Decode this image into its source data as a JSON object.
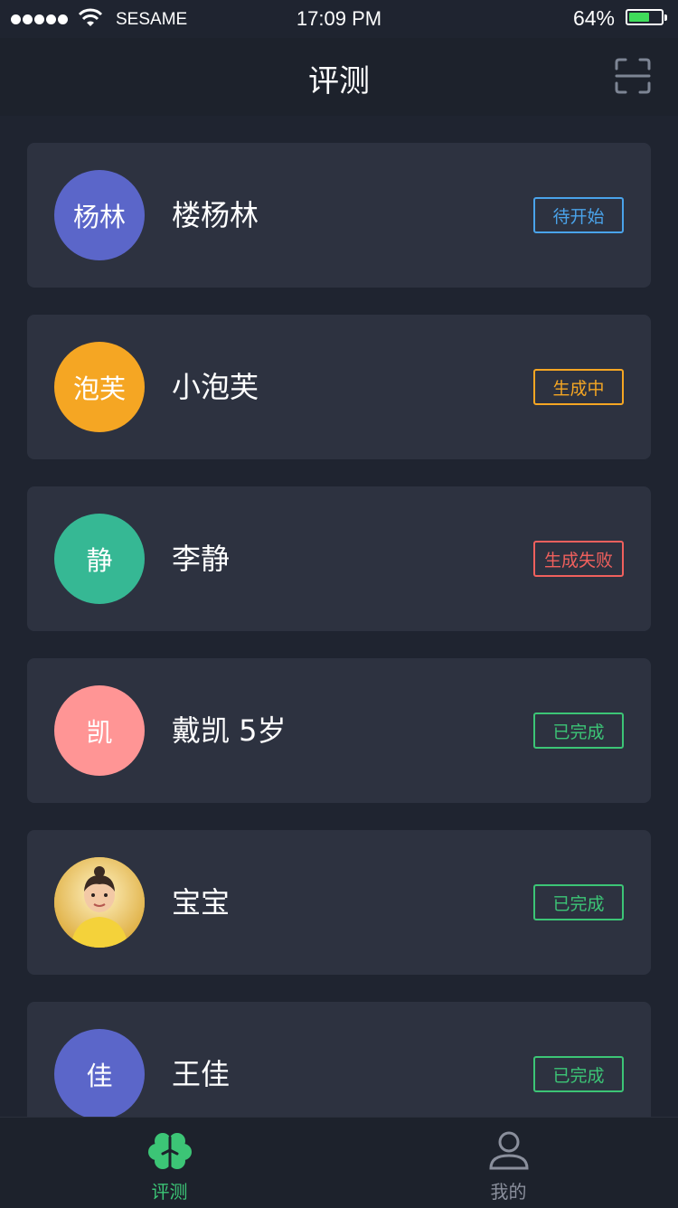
{
  "status_bar": {
    "carrier": "SESAME",
    "time": "17:09 PM",
    "battery_percent": "64%",
    "battery_level": 0.64,
    "signal_icon": "signal-dots-icon",
    "wifi_icon": "wifi-icon"
  },
  "nav": {
    "title": "评测",
    "scan_icon": "scan-icon"
  },
  "colors": {
    "background": "#1f2430",
    "card": "#2d3240",
    "status_pending": "#4aa3ea",
    "status_generating": "#f5a623",
    "status_failed": "#f0605d",
    "status_done": "#3cc576",
    "tab_active": "#3cc576",
    "tab_inactive": "#8a8f9c"
  },
  "assessments": [
    {
      "avatar_text": "杨林",
      "avatar_color": "#5b66c9",
      "name": "楼杨林",
      "status": "待开始",
      "status_color": "#4aa3ea"
    },
    {
      "avatar_text": "泡芙",
      "avatar_color": "#f5a623",
      "name": "小泡芙",
      "status": "生成中",
      "status_color": "#f5a623"
    },
    {
      "avatar_text": "静",
      "avatar_color": "#36b894",
      "name": "李静",
      "status": "生成失败",
      "status_color": "#f0605d"
    },
    {
      "avatar_text": "凯",
      "avatar_color": "#ff9595",
      "name": "戴凯 5岁",
      "status": "已完成",
      "status_color": "#3cc576"
    },
    {
      "avatar_text": "",
      "avatar_color": "#e9c13a",
      "name": "宝宝",
      "status": "已完成",
      "status_color": "#3cc576",
      "avatar_photo": "child-photo"
    },
    {
      "avatar_text": "佳",
      "avatar_color": "#5b66c9",
      "name": "王佳",
      "status": "已完成",
      "status_color": "#3cc576"
    }
  ],
  "tabs": [
    {
      "label": "评测",
      "icon": "brain-icon",
      "active": true
    },
    {
      "label": "我的",
      "icon": "person-icon",
      "active": false
    }
  ]
}
